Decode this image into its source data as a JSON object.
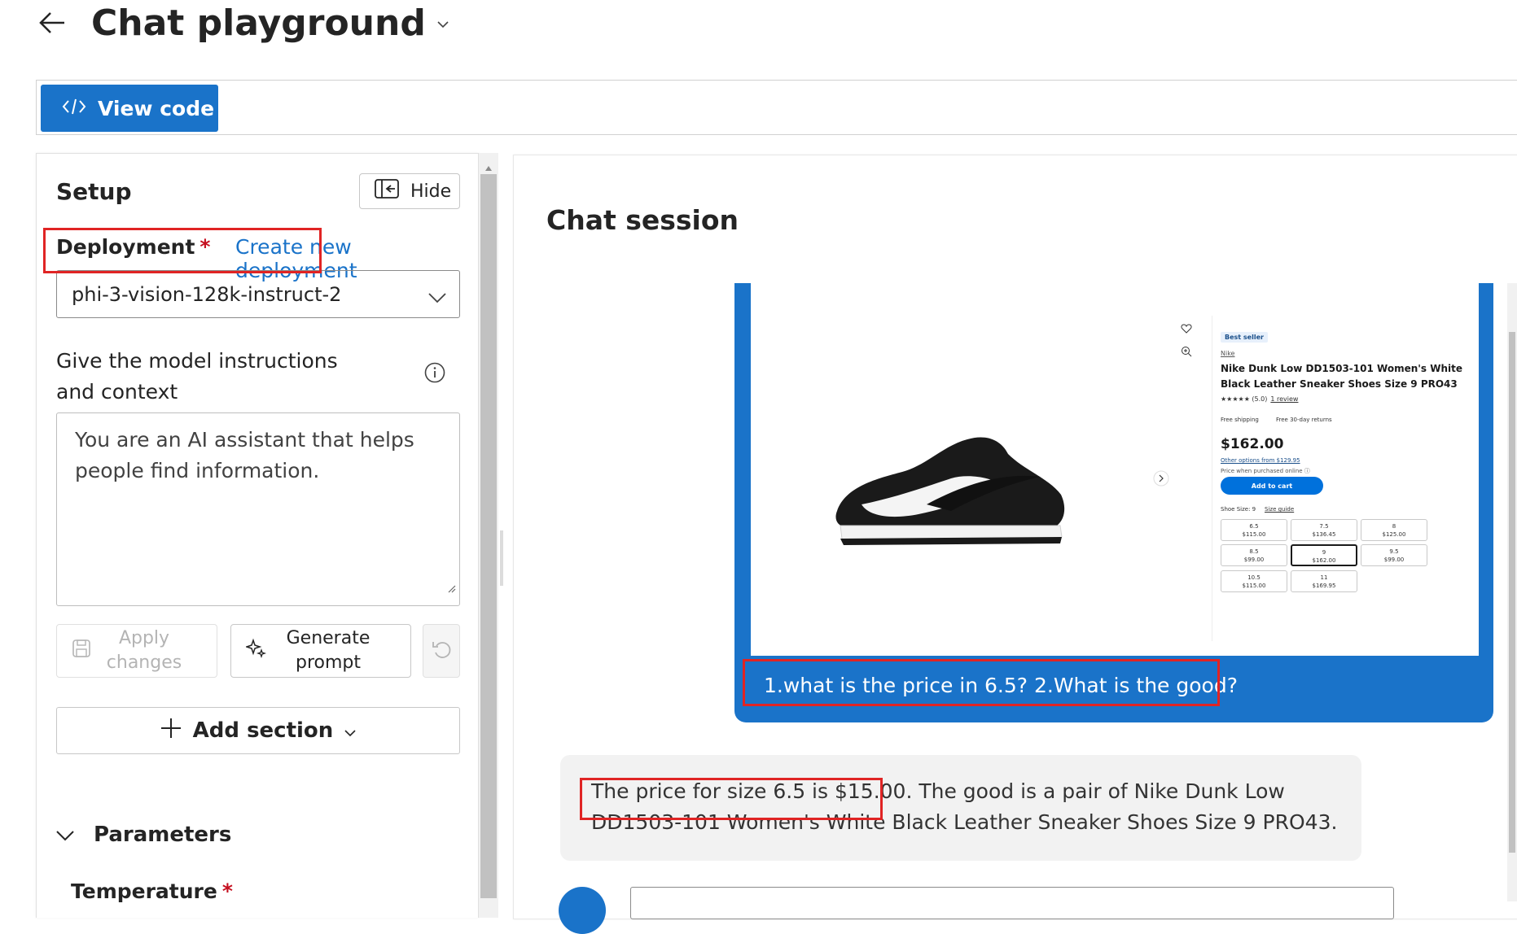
{
  "header": {
    "title": "Chat playground"
  },
  "toolbar": {
    "view_code_label": "View code"
  },
  "setup": {
    "title": "Setup",
    "hide_label": "Hide",
    "deployment_label": "Deployment",
    "required_mark": "*",
    "create_link": "Create new deployment",
    "deployment_value": "phi-3-vision-128k-instruct-2",
    "instructions_label": "Give the model instructions and context",
    "system_message": "You are an AI assistant that helps people find information.",
    "apply_label": "Apply changes",
    "generate_label": "Generate prompt",
    "add_section_label": "Add section",
    "parameters_label": "Parameters",
    "temperature_label": "Temperature"
  },
  "chat": {
    "title": "Chat session",
    "user_message": "1.what is the price in 6.5? 2.What is the good?",
    "assistant_message_highlight": "The price for size 6.5 is $15.00.",
    "assistant_message_rest": " The good is a pair of Nike Dunk Low DD1503-101 Women's White Black Leather Sneaker Shoes Size 9 PRO43."
  },
  "product": {
    "badge": "Best seller",
    "brand": "Nike",
    "title": "Nike Dunk Low DD1503-101 Women's White Black Leather Sneaker Shoes Size 9 PRO43",
    "rating": "★★★★★ (5.0)",
    "reviews": "1 review",
    "shipping": "Free shipping",
    "returns": "Free 30-day returns",
    "price": "$162.00",
    "other_options": "Other options from $129.95",
    "price_note": "Price when purchased online ⓘ",
    "add_to_cart": "Add to cart",
    "shoe_size": "Shoe Size: 9",
    "size_guide": "Size guide",
    "sizes": [
      {
        "size": "6.5",
        "price": "$115.00"
      },
      {
        "size": "7.5",
        "price": "$136.45"
      },
      {
        "size": "8",
        "price": "$125.00"
      },
      {
        "size": "8.5",
        "price": "$99.00"
      },
      {
        "size": "9",
        "price": "$162.00"
      },
      {
        "size": "9.5",
        "price": "$99.00"
      },
      {
        "size": "10.5",
        "price": "$115.00"
      },
      {
        "size": "11",
        "price": "$169.95"
      }
    ]
  },
  "colors": {
    "accent": "#1a73c9",
    "highlight_box": "#e02424"
  }
}
